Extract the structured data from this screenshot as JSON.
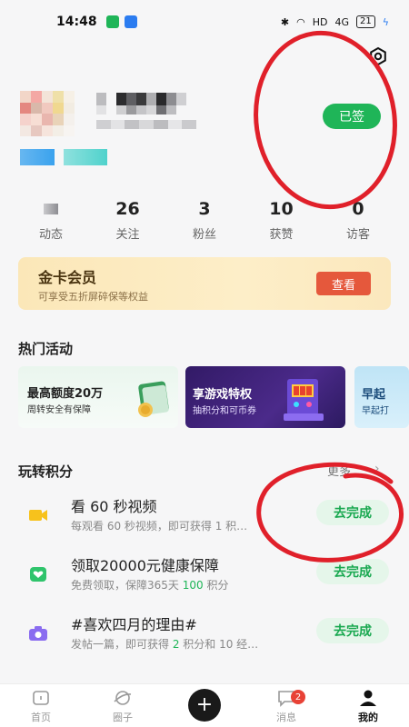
{
  "status_bar": {
    "time": "14:48",
    "battery": "21",
    "net1": "HD",
    "net2": "4G"
  },
  "profile": {
    "signed_button": "已签"
  },
  "stats": [
    {
      "value": "",
      "label": "动态"
    },
    {
      "value": "26",
      "label": "关注"
    },
    {
      "value": "3",
      "label": "粉丝"
    },
    {
      "value": "10",
      "label": "获赞"
    },
    {
      "value": "0",
      "label": "访客"
    }
  ],
  "vip": {
    "title": "金卡会员",
    "subtitle": "可享受五折屏碎保等权益",
    "button": "查看"
  },
  "hot_activities": {
    "title": "热门活动",
    "banners": [
      {
        "title": "最高额度20万",
        "subtitle": "周转安全有保障"
      },
      {
        "title": "享游戏特权",
        "subtitle": "抽积分和可币券"
      },
      {
        "title": "早起",
        "subtitle": "早起打"
      }
    ]
  },
  "points": {
    "title": "玩转积分",
    "more": "更多",
    "tasks": [
      {
        "title": "看 60 秒视频",
        "desc_pre": "每观看 60 秒视频，即可获得 1",
        "desc_pts": "",
        "desc_post": " 积…",
        "button": "去完成",
        "icon": "video-icon",
        "color": "#f7c21c"
      },
      {
        "title": "领取20000元健康保障",
        "desc_pre": "免费领取，保障365天 ",
        "desc_pts": "100",
        "desc_post": " 积分",
        "button": "去完成",
        "icon": "health-shield-icon",
        "color": "#2fc46c"
      },
      {
        "title": "#喜欢四月的理由#",
        "desc_pre": "发帖一篇，即可获得 ",
        "desc_pts": "2",
        "desc_post": " 积分和 10 经…",
        "button": "去完成",
        "icon": "camera-icon",
        "color": "#8a6cf0"
      }
    ]
  },
  "tabbar": {
    "tabs": [
      {
        "label": "首页"
      },
      {
        "label": "圈子"
      },
      {
        "label": ""
      },
      {
        "label": "消息",
        "badge": "2"
      },
      {
        "label": "我的"
      }
    ]
  },
  "colors": {
    "primary": "#1fb558",
    "accent": "#e5583c",
    "annotation": "#e0202a"
  }
}
